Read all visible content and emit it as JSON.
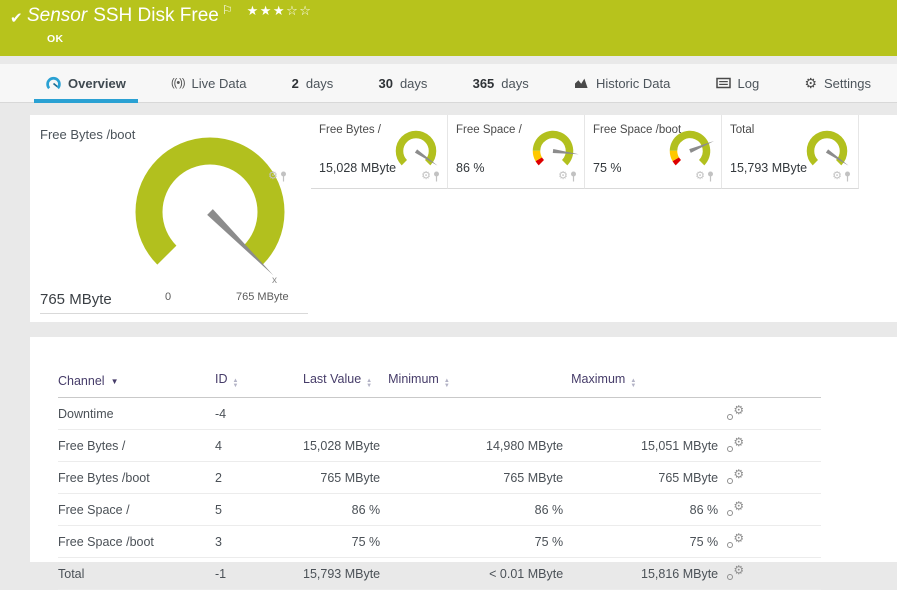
{
  "header": {
    "type_label": "Sensor",
    "title": "SSH Disk Free",
    "status": "OK",
    "priority": {
      "filled": 3,
      "total": 5
    },
    "colors": {
      "background": "#b7c31c",
      "text": "#ffffff"
    }
  },
  "tabs": [
    {
      "label": "Overview",
      "icon": "gauge-icon",
      "active": true
    },
    {
      "label": "Live Data",
      "icon": "live-signal-icon",
      "active": false
    },
    {
      "strong": "2",
      "label": "days",
      "active": false
    },
    {
      "strong": "30",
      "label": "days",
      "active": false
    },
    {
      "strong": "365",
      "label": "days",
      "active": false
    },
    {
      "label": "Historic Data",
      "icon": "area-chart-icon",
      "active": false
    },
    {
      "label": "Log",
      "icon": "log-list-icon",
      "active": false
    },
    {
      "label": "Settings",
      "icon": "gear-icon",
      "active": false
    }
  ],
  "chart_data": [
    {
      "type": "gauge",
      "title": "Free Bytes /boot",
      "value": 765,
      "unit": "MByte",
      "value_label": "765 MByte",
      "min": 0,
      "max": 765,
      "scale_min_label": "0",
      "scale_max_label": "765 MByte",
      "fraction": 1.0,
      "needle_marker": "x",
      "segments": [
        {
          "from": 0,
          "to": 1,
          "color": "#b2c01e"
        }
      ]
    },
    {
      "type": "gauge",
      "title": "Free Bytes /",
      "value": 15028,
      "unit": "MByte",
      "value_label": "15,028 MByte",
      "fraction": 0.96,
      "segments": [
        {
          "from": 0,
          "to": 1,
          "color": "#b2c01e"
        }
      ]
    },
    {
      "type": "gauge",
      "title": "Free Space /",
      "value": 86,
      "unit": "%",
      "value_label": "86 %",
      "fraction": 0.86,
      "segments": [
        {
          "from": 0,
          "to": 0.055,
          "color": "#dd0000"
        },
        {
          "from": 0.055,
          "to": 0.17,
          "color": "#ffc800"
        },
        {
          "from": 0.17,
          "to": 1,
          "color": "#b2c01e"
        }
      ]
    },
    {
      "type": "gauge",
      "title": "Free Space /boot",
      "value": 75,
      "unit": "%",
      "value_label": "75 %",
      "fraction": 0.75,
      "segments": [
        {
          "from": 0,
          "to": 0.055,
          "color": "#dd0000"
        },
        {
          "from": 0.055,
          "to": 0.17,
          "color": "#ffc800"
        },
        {
          "from": 0.17,
          "to": 1,
          "color": "#b2c01e"
        }
      ]
    },
    {
      "type": "gauge",
      "title": "Total",
      "value": 15793,
      "unit": "MByte",
      "value_label": "15,793 MByte",
      "fraction": 0.96,
      "segments": [
        {
          "from": 0,
          "to": 1,
          "color": "#b2c01e"
        }
      ]
    }
  ],
  "channels_table": {
    "columns": [
      {
        "label": "Channel",
        "sort": "desc"
      },
      {
        "label": "ID",
        "sort": "both"
      },
      {
        "label": "Last Value",
        "sort": "both"
      },
      {
        "label": "Minimum",
        "sort": "both"
      },
      {
        "label": "Maximum",
        "sort": "both"
      }
    ],
    "rows": [
      {
        "channel": "Downtime",
        "id": "-4",
        "last": "",
        "min": "",
        "max": ""
      },
      {
        "channel": "Free Bytes /",
        "id": "4",
        "last": "15,028 MByte",
        "min": "14,980 MByte",
        "max": "15,051 MByte"
      },
      {
        "channel": "Free Bytes /boot",
        "id": "2",
        "last": "765 MByte",
        "min": "765 MByte",
        "max": "765 MByte"
      },
      {
        "channel": "Free Space /",
        "id": "5",
        "last": "86 %",
        "min": "86 %",
        "max": "86 %"
      },
      {
        "channel": "Free Space /boot",
        "id": "3",
        "last": "75 %",
        "min": "75 %",
        "max": "75 %"
      },
      {
        "channel": "Total",
        "id": "-1",
        "last": "15,793 MByte",
        "min": "< 0.01 MByte",
        "max": "15,816 MByte"
      }
    ]
  },
  "colors": {
    "accent_blue": "#2aa1d3",
    "gauge_green": "#b2c01e",
    "warning_yellow": "#ffc800",
    "error_red": "#dd0000",
    "needle_gray": "#8c8c8c"
  }
}
